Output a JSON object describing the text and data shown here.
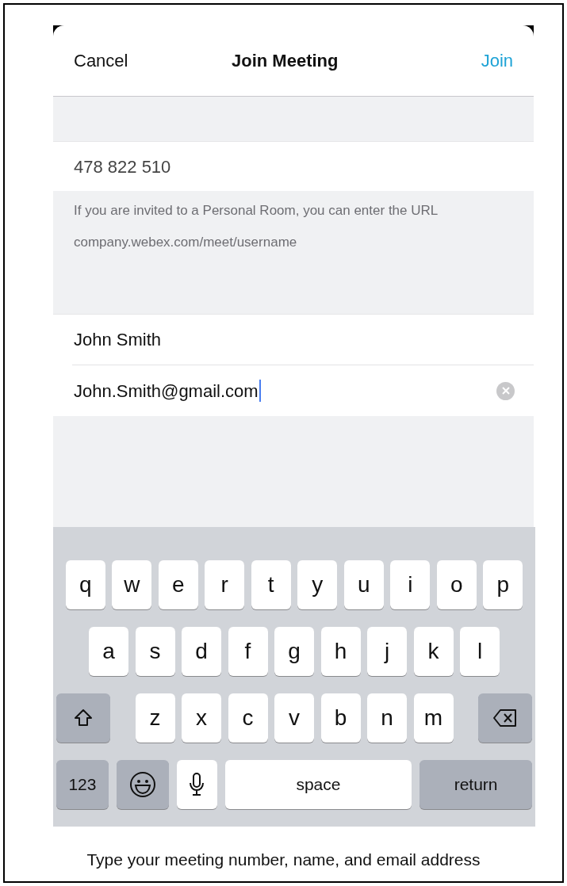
{
  "nav": {
    "cancel": "Cancel",
    "title": "Join Meeting",
    "join": "Join"
  },
  "meeting_number": "478 822 510",
  "hint": {
    "text": "If you are invited to a Personal Room, you can enter the URL",
    "example": "company.webex.com/meet/username"
  },
  "fields": [
    {
      "value": "John Smith",
      "focused": false
    },
    {
      "value": "John.Smith@gmail.com",
      "focused": true
    }
  ],
  "keyboard": [
    [
      {
        "kind": "letter",
        "label": "q"
      },
      {
        "kind": "letter",
        "label": "w"
      },
      {
        "kind": "letter",
        "label": "e"
      },
      {
        "kind": "letter",
        "label": "r"
      },
      {
        "kind": "letter",
        "label": "t"
      },
      {
        "kind": "letter",
        "label": "y"
      },
      {
        "kind": "letter",
        "label": "u"
      },
      {
        "kind": "letter",
        "label": "i"
      },
      {
        "kind": "letter",
        "label": "o"
      },
      {
        "kind": "letter",
        "label": "p"
      }
    ],
    [
      {
        "kind": "letter",
        "label": "a"
      },
      {
        "kind": "letter",
        "label": "s"
      },
      {
        "kind": "letter",
        "label": "d"
      },
      {
        "kind": "letter",
        "label": "f"
      },
      {
        "kind": "letter",
        "label": "g"
      },
      {
        "kind": "letter",
        "label": "h"
      },
      {
        "kind": "letter",
        "label": "j"
      },
      {
        "kind": "letter",
        "label": "k"
      },
      {
        "kind": "letter",
        "label": "l"
      }
    ],
    [
      {
        "kind": "shift"
      },
      {
        "kind": "letter",
        "label": "z"
      },
      {
        "kind": "letter",
        "label": "x"
      },
      {
        "kind": "letter",
        "label": "c"
      },
      {
        "kind": "letter",
        "label": "v"
      },
      {
        "kind": "letter",
        "label": "b"
      },
      {
        "kind": "letter",
        "label": "n"
      },
      {
        "kind": "letter",
        "label": "m"
      },
      {
        "kind": "delete"
      }
    ],
    [
      {
        "kind": "numbers",
        "label": "123"
      },
      {
        "kind": "emoji"
      },
      {
        "kind": "mic"
      },
      {
        "kind": "space",
        "label": "space"
      },
      {
        "kind": "return",
        "label": "return"
      }
    ]
  ],
  "caption": "Type your meeting number, name, and email address"
}
